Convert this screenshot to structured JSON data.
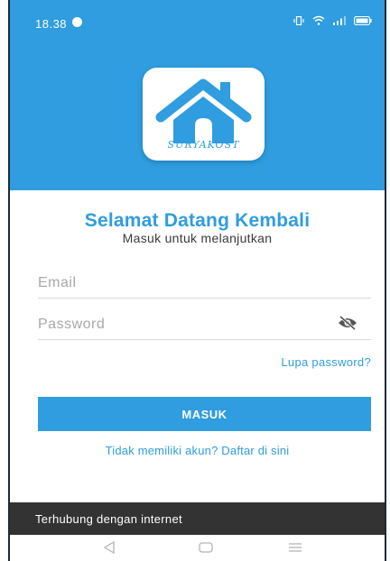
{
  "status_bar": {
    "time": "18.38",
    "icons": [
      "whatsapp-icon",
      "vibrate-icon",
      "wifi-icon",
      "signal-icon",
      "battery-icon"
    ]
  },
  "logo": {
    "text": "SURYAKOST",
    "icon": "house-icon"
  },
  "login": {
    "title": "Selamat Datang Kembali",
    "subtitle": "Masuk untuk melanjutkan",
    "email_placeholder": "Email",
    "password_placeholder": "Password",
    "forgot_password": "Lupa password?",
    "submit_label": "MASUK",
    "register_link": "Tidak memiliki akun? Daftar di sini"
  },
  "snackbar": {
    "message": "Terhubung dengan internet"
  },
  "navbar": {
    "buttons": [
      "back-icon",
      "home-icon",
      "menu-icon"
    ]
  },
  "colors": {
    "primary": "#2f9ddf",
    "snackbar": "#333333",
    "text": "#3a3a3a",
    "placeholder": "#a8a8a8"
  }
}
